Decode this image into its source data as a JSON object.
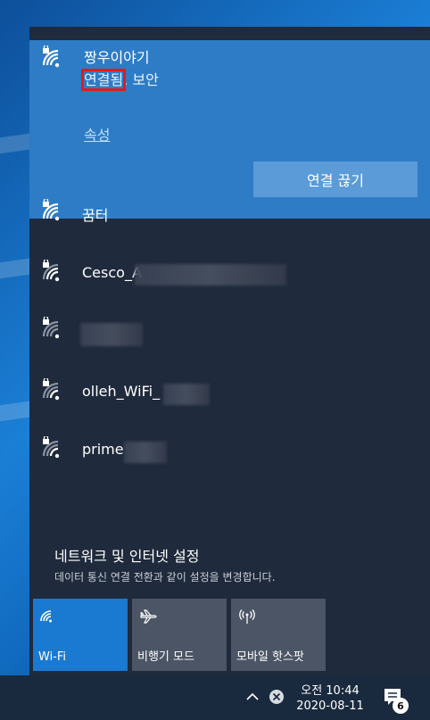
{
  "connected_network": {
    "ssid": "짱우이야기",
    "status_highlighted": "연결됨",
    "status_rest": ", 보안",
    "properties_link": "속성",
    "disconnect_button": "연결 끊기"
  },
  "networks": [
    {
      "ssid": "꿈터",
      "secured": true
    },
    {
      "ssid": "Cesco_A",
      "secured": true,
      "partially_hidden": true
    },
    {
      "ssid": "",
      "secured": true,
      "partially_hidden": true
    },
    {
      "ssid": "olleh_WiFi_",
      "secured": true,
      "partially_hidden": true
    },
    {
      "ssid": "prime",
      "secured": true,
      "partially_hidden": true
    }
  ],
  "settings": {
    "title": "네트워크 및 인터넷 설정",
    "description": "데이터 통신 연결 전환과 같이 설정을 변경합니다."
  },
  "quick_actions": [
    {
      "label": "Wi-Fi",
      "icon": "wifi-icon",
      "active": true
    },
    {
      "label": "비행기 모드",
      "icon": "airplane-icon",
      "active": false
    },
    {
      "label": "모바일 핫스팟",
      "icon": "hotspot-icon",
      "active": false
    }
  ],
  "taskbar": {
    "time": "오전 10:44",
    "date": "2020-08-11",
    "notification_count": "6"
  },
  "colors": {
    "accent": "#1a7ad1",
    "connected_bg": "#2d7cc5",
    "flyout_bg": "#1f2a3c",
    "highlight_box": "#e01b1b"
  }
}
